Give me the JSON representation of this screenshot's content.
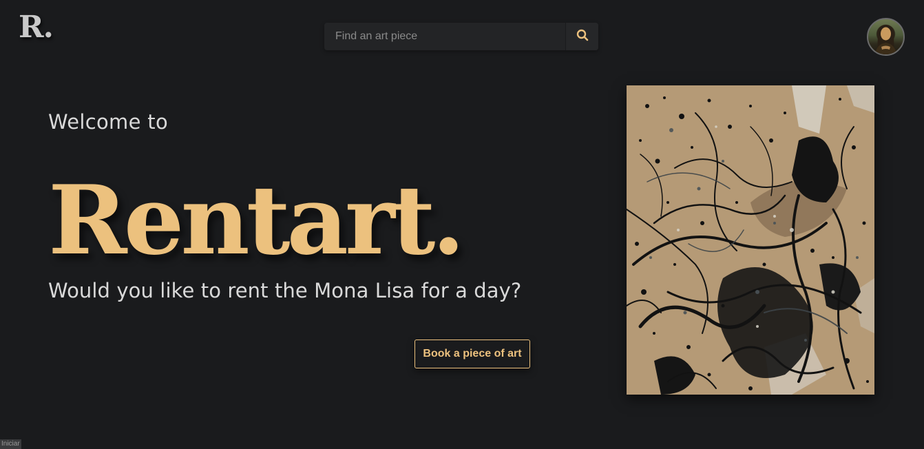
{
  "header": {
    "logo": "R.",
    "search": {
      "placeholder": "Find an art piece",
      "value": ""
    },
    "search_icon": "search-icon",
    "avatar": "mona-lisa-avatar"
  },
  "hero": {
    "welcome": "Welcome to",
    "title": "Rentart.",
    "tagline": "Would you like to rent the Mona Lisa for a day?",
    "cta_label": "Book a piece of art"
  },
  "artwork": {
    "description": "abstract-drip-painting"
  },
  "footer_tag": "Iniciar",
  "colors": {
    "background": "#1a1b1d",
    "accent": "#ecc17e",
    "text": "#d9d9d9",
    "search_bg": "#232426",
    "art_canvas": "#b59a76"
  }
}
